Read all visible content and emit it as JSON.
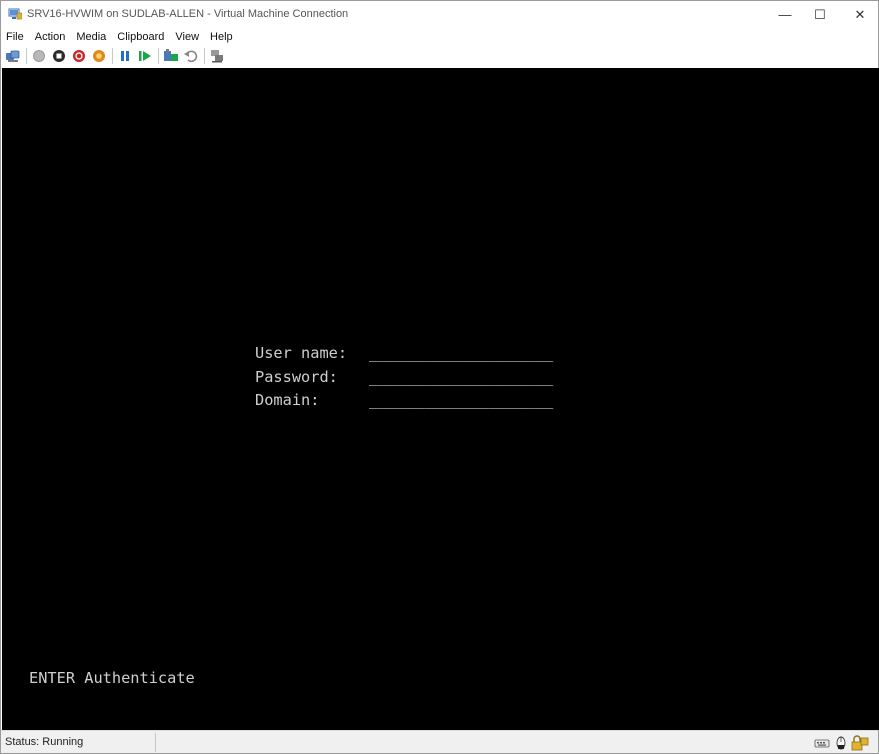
{
  "window": {
    "title": "SRV16-HVWIM on SUDLAB-ALLEN - Virtual Machine Connection",
    "controls": {
      "minimize": "—",
      "maximize": "☐",
      "close": "✕"
    }
  },
  "menu": [
    "File",
    "Action",
    "Media",
    "Clipboard",
    "View",
    "Help"
  ],
  "toolbar": {
    "icons": [
      "ctrl-alt-del-icon",
      "start-icon",
      "turn-off-icon",
      "shut-down-icon",
      "save-icon",
      "pause-icon",
      "resume-icon",
      "checkpoint-icon",
      "revert-icon",
      "enhanced-session-icon"
    ],
    "colors": {
      "gray": "#b8b8b8",
      "dark": "#2b2b2b",
      "red": "#c0282a",
      "orange": "#e08a1e",
      "blue": "#1f6fc4",
      "green": "#1aa64a"
    }
  },
  "console": {
    "username_label": "User name:",
    "password_label": "Password:",
    "domain_label": "Domain:",
    "field_placeholder": "____________________",
    "footer_hint": "ENTER Authenticate",
    "background": "#000000",
    "text_color": "#cfcfcf"
  },
  "statusbar": {
    "status": "Status: Running",
    "tray_icons": [
      "keyboard-icon",
      "mouse-icon",
      "lock-icon"
    ]
  }
}
